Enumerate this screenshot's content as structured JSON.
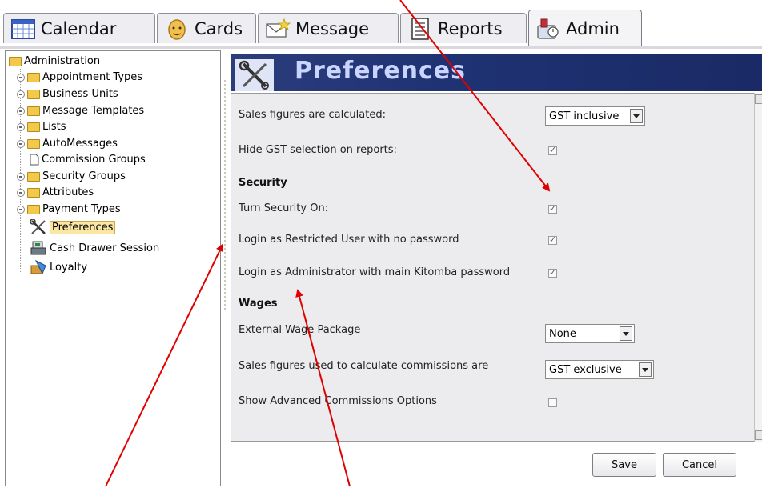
{
  "tabs": [
    {
      "label": "Calendar",
      "icon": "calendar-icon"
    },
    {
      "label": "Cards",
      "icon": "face-icon"
    },
    {
      "label": "Message",
      "icon": "envelope-icon"
    },
    {
      "label": "Reports",
      "icon": "report-icon"
    },
    {
      "label": "Admin",
      "icon": "admin-icon",
      "active": true
    }
  ],
  "tree": {
    "root": "Administration",
    "items": [
      "Appointment Types",
      "Business Units",
      "Message Templates",
      "Lists",
      "AutoMessages",
      "Commission Groups",
      "Security Groups",
      "Attributes",
      "Payment Types",
      "Preferences",
      "Cash Drawer Session",
      "Loyalty"
    ],
    "selected": "Preferences"
  },
  "header": {
    "title": "Preferences",
    "icon": "tools-icon"
  },
  "preferences": {
    "sales_calc_label": "Sales figures are calculated:",
    "sales_calc_value": "GST inclusive",
    "hide_gst_label": "Hide GST selection on reports:",
    "hide_gst_checked": true,
    "security_heading": "Security",
    "turn_security_label": "Turn Security On:",
    "turn_security_checked": true,
    "restricted_label": "Login as Restricted User with no password",
    "restricted_checked": true,
    "admin_login_label": "Login as Administrator with main Kitomba password",
    "admin_login_checked": true,
    "wages_heading": "Wages",
    "wage_pkg_label": "External Wage Package",
    "wage_pkg_value": "None",
    "commission_label": "Sales figures used to calculate commissions are",
    "commission_value": "GST exclusive",
    "advanced_label": "Show Advanced Commissions Options",
    "advanced_checked": false
  },
  "buttons": {
    "save": "Save",
    "cancel": "Cancel"
  },
  "colors": {
    "header_bg": "#1f3273",
    "header_text": "#c9d4ff",
    "annotation_arrow": "#e00000"
  }
}
